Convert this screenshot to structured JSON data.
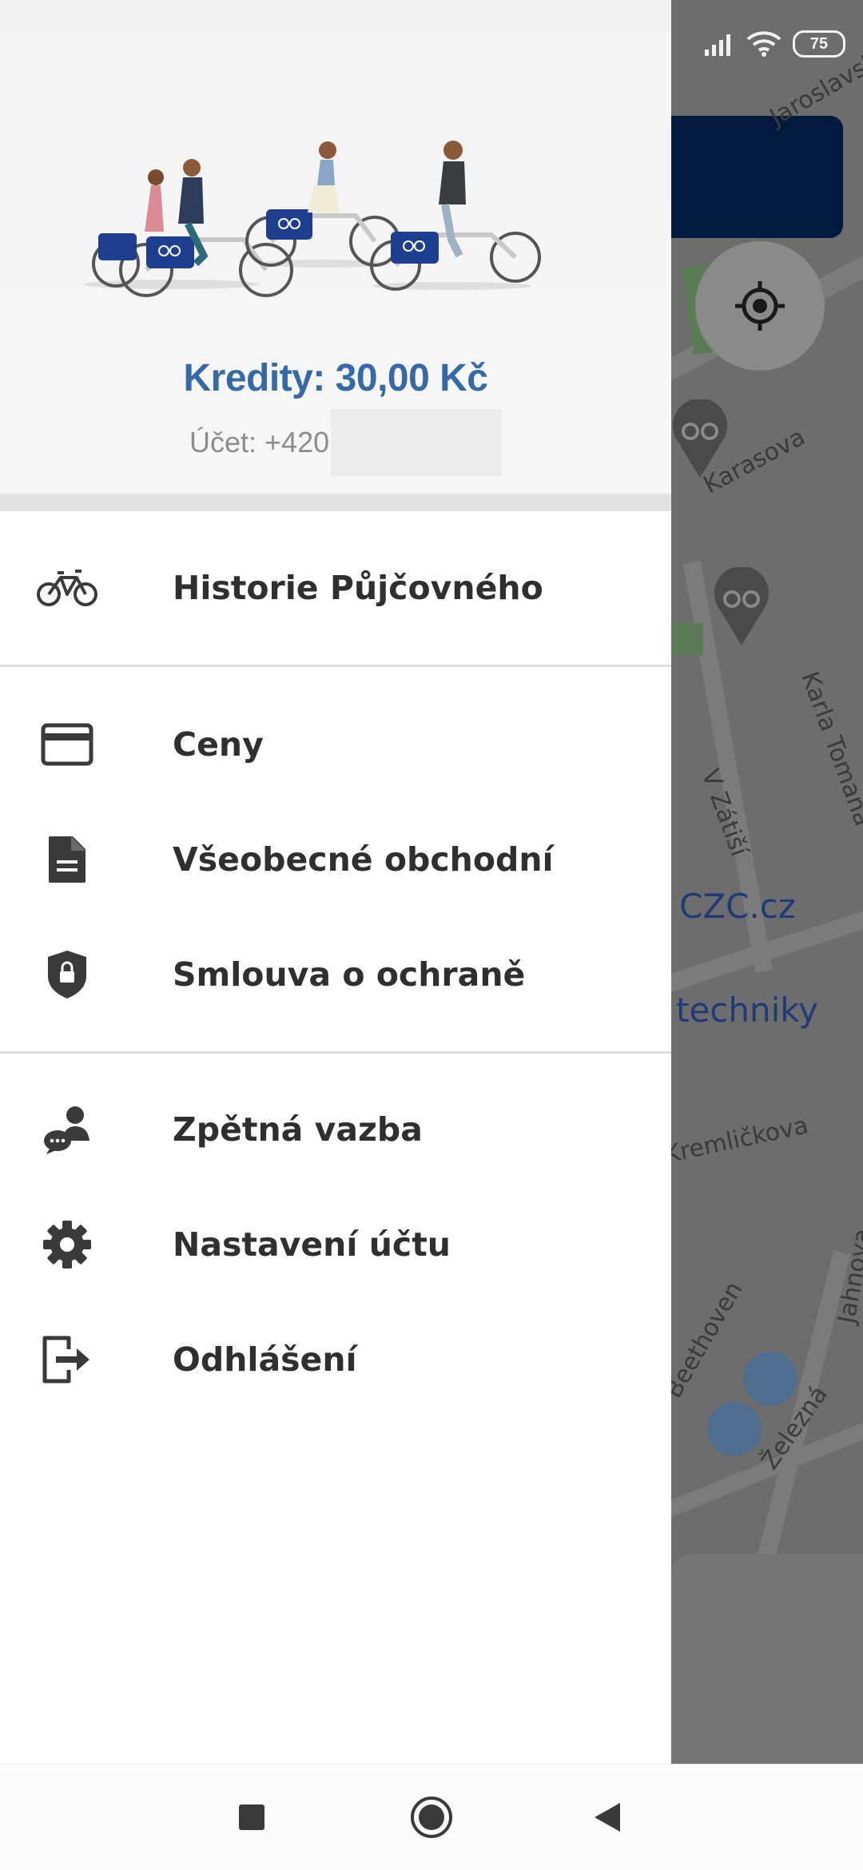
{
  "status_bar": {
    "battery_level": "75"
  },
  "map": {
    "streets": [
      "Jaroslavska",
      "Karasova",
      "Karla Tomana",
      "V Zátiší",
      "Kremličkova",
      "Jahnova",
      "Železná",
      "Beethoven"
    ],
    "places": [
      "CZC.cz",
      "techniky"
    ]
  },
  "drawer": {
    "credits": "Kredity: 30,00 Kč",
    "account_label": "Účet: +420",
    "menu": [
      {
        "label": "Historie Půjčovného",
        "icon": "bicycle-icon"
      },
      {
        "label": "Ceny",
        "icon": "credit-card-icon"
      },
      {
        "label": "Všeobecné obchodní",
        "icon": "document-icon"
      },
      {
        "label": "Smlouva o ochraně",
        "icon": "shield-lock-icon"
      },
      {
        "label": "Zpětná vazba",
        "icon": "feedback-icon"
      },
      {
        "label": "Nastavení účtu",
        "icon": "gear-icon"
      },
      {
        "label": "Odhlášení",
        "icon": "logout-icon"
      }
    ]
  },
  "navbar": {
    "buttons": [
      "recents-button",
      "home-button",
      "back-button"
    ]
  },
  "colors": {
    "accent": "#3669a8",
    "banner": "#021a3d",
    "text": "#2f2f2f"
  }
}
